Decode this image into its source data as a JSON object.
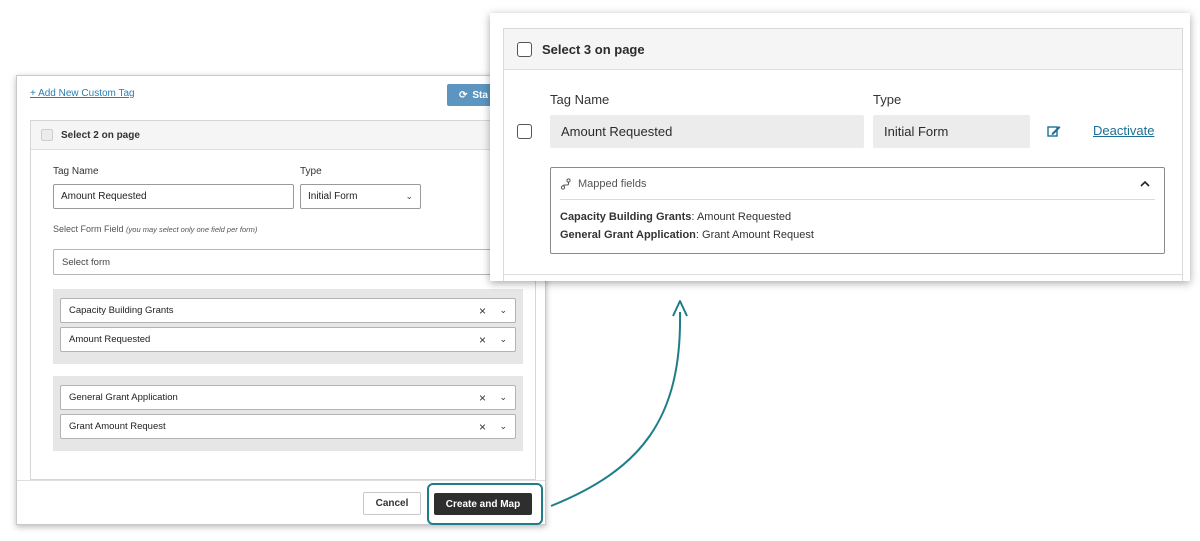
{
  "left_panel": {
    "add_tag_link": "+ Add New Custom Tag",
    "start_button": "Sta",
    "select_all_label": "Select 2 on page",
    "tag_name_label": "Tag Name",
    "tag_name_value": "Amount Requested",
    "type_label": "Type",
    "type_value": "Initial Form",
    "form_field_label": "Select Form Field",
    "form_field_hint": "(you may select only one field per form)",
    "select_form_placeholder": "Select form",
    "groups": [
      {
        "form": "Capacity Building Grants",
        "field": "Amount Requested"
      },
      {
        "form": "General Grant Application",
        "field": "Grant Amount Request"
      }
    ],
    "cancel_button": "Cancel",
    "create_button": "Create and Map"
  },
  "right_panel": {
    "select_all_label": "Select 3 on page",
    "tag_name_header": "Tag Name",
    "type_header": "Type",
    "tag_name_value": "Amount Requested",
    "type_value": "Initial Form",
    "deactivate_link": "Deactivate",
    "mapped_fields_title": "Mapped fields",
    "mappings": [
      {
        "form": "Capacity Building Grants",
        "field": "Amount Requested"
      },
      {
        "form": "General Grant Application",
        "field": "Grant Amount Request"
      }
    ]
  },
  "colors": {
    "accent_teal": "#1f7d8a",
    "link_blue": "#1d6f95",
    "primary_dark": "#2e2e2e",
    "start_button_blue": "#5c96c0"
  }
}
